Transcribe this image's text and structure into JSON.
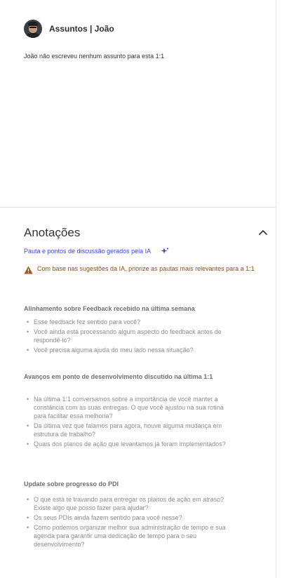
{
  "header": {
    "title": "Assuntos | João"
  },
  "top": {
    "empty_message": "João não escreveu nenhum assunto para esta 1:1"
  },
  "notes": {
    "title": "Anotações",
    "generated_link": "Pauta e pontos de discussão gerados pela IA",
    "warning": "Com base nas sugestões da IA, priorize as pautas mais relevantes para a 1:1",
    "sections": [
      {
        "title": "Alinhamento sobre Feedback recebido na última semana",
        "items": [
          "Esse feedback fez sentido para você?",
          "Você ainda está processando algum aspecto do feedback antes de respondê-lo?",
          "Você precisa alguma ajuda do meu lado nessa situação?"
        ]
      },
      {
        "title": "Avanços em ponto de desenvolvimento discutido na última 1:1",
        "items": [
          "Na última 1:1 conversamos sobre a importância de você manter a constância com as suas entregas. O que você ajustou na sua rotina para facilitar essa melhoria?",
          "Da última vez que falamos para agora, houve alguma mudança em estrutura de trabalho?",
          "Quais dos planos de ação que levantamos já foram implementados?"
        ]
      },
      {
        "title": "Update sobre progresso do PDI",
        "items": [
          "O que está te travando para entregar os planos de ação em atraso? Existe algo que posso fazer para ajudar?",
          "Os seus PDIs ainda fazem sentido para você nesse?",
          "Como podemos organizar melhor sua administração de tempo e sua agenda para garantir uma dedicação de tempo para o seu desenvolvimento?"
        ]
      }
    ]
  },
  "colors": {
    "link": "#3b47c9",
    "warning_text": "#8a5300",
    "warning_icon": "#a05a00"
  },
  "icons": {
    "collapse": "chevron-up-icon",
    "sparkle": "sparkle-icon",
    "warning": "warning-icon"
  }
}
